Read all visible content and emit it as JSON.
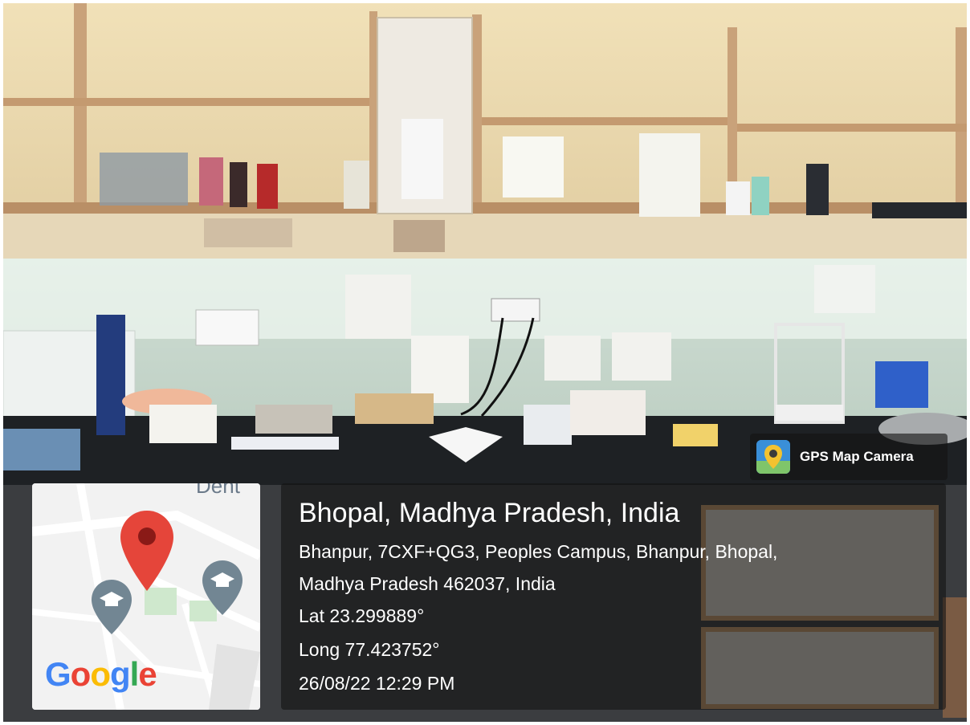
{
  "overlay": {
    "app_name": "GPS Map Camera",
    "title": "Bhopal, Madhya Pradesh, India",
    "address_line1": "Bhanpur, 7CXF+QG3, Peoples Campus, Bhanpur, Bhopal,",
    "address_line2": "Madhya Pradesh 462037, India",
    "lat": "Lat 23.299889°",
    "long": "Long 77.423752°",
    "datetime": "26/08/22 12:29 PM"
  },
  "map": {
    "logo": "Google",
    "partial_label": "Dent",
    "pin_icon": "location-pin-icon",
    "place_icon": "school-place-icon"
  },
  "colors": {
    "pin_red": "#e5453a",
    "google_blue": "#4285F4",
    "google_red": "#EA4335",
    "google_yellow": "#FBBC05",
    "google_green": "#34A853"
  }
}
